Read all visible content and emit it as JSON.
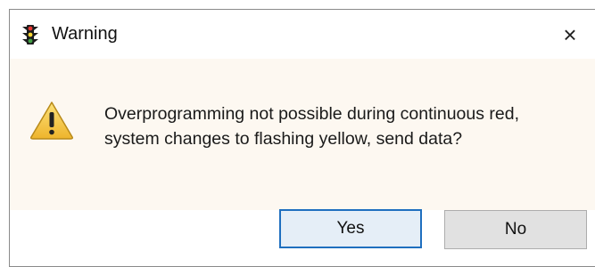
{
  "window": {
    "title": "Warning",
    "icon": "traffic-light-icon",
    "close_label": "×"
  },
  "dialog": {
    "icon": "warning-triangle-icon",
    "message_line1": "Overprogramming not possible during continuous red,",
    "message_line2": "system changes to flashing yellow, send data?"
  },
  "buttons": {
    "yes_label": "Yes",
    "no_label": "No"
  },
  "colors": {
    "content_background": "#fdf8f1",
    "default_button_border": "#1f6fbf",
    "warning_yellow": "#f5c342"
  }
}
